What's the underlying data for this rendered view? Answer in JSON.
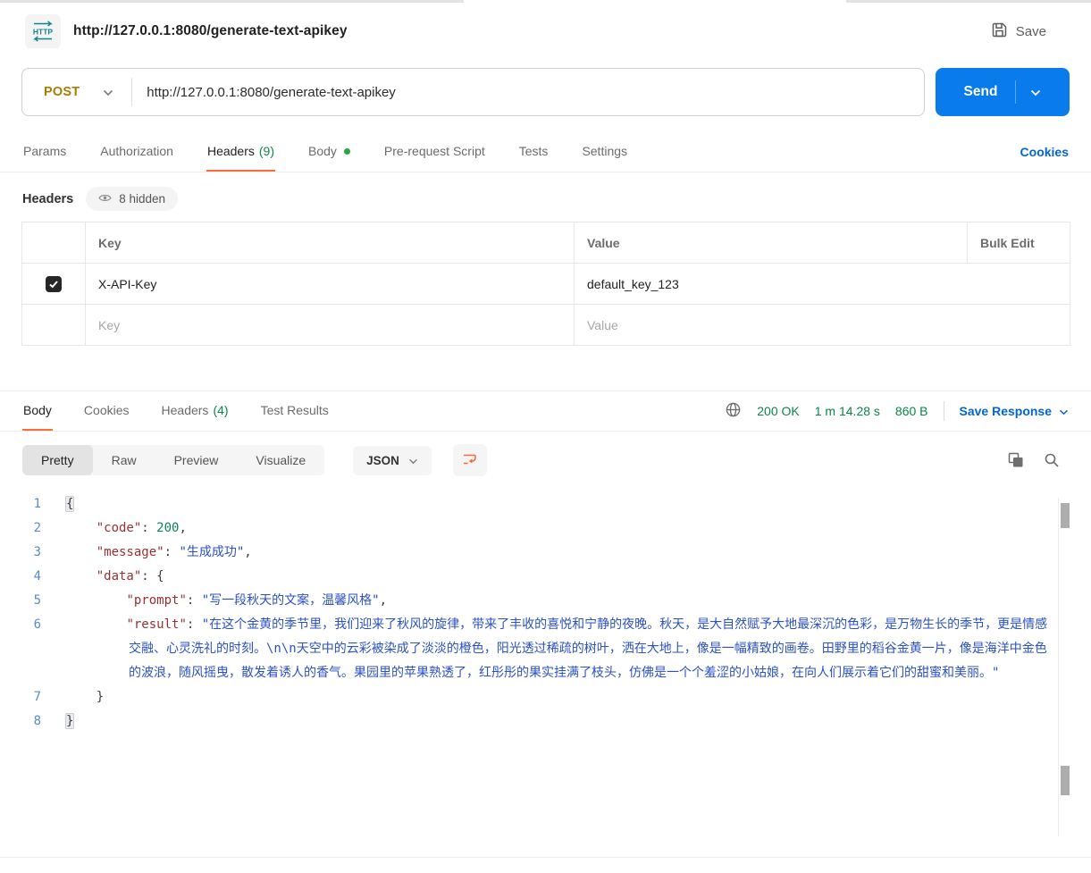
{
  "header": {
    "badge": "HTTP",
    "title": "http://127.0.0.1:8080/generate-text-apikey",
    "save_label": "Save"
  },
  "request": {
    "method": "POST",
    "url": "http://127.0.0.1:8080/generate-text-apikey",
    "send_label": "Send"
  },
  "request_tabs": {
    "items": [
      {
        "label": "Params"
      },
      {
        "label": "Authorization"
      },
      {
        "label": "Headers",
        "count": "(9)",
        "active": true
      },
      {
        "label": "Body",
        "dot": true
      },
      {
        "label": "Pre-request Script"
      },
      {
        "label": "Tests"
      },
      {
        "label": "Settings"
      }
    ],
    "cookies_link": "Cookies"
  },
  "headers_editor": {
    "title": "Headers",
    "hidden_badge": "8 hidden",
    "columns": {
      "key": "Key",
      "value": "Value",
      "bulk": "Bulk Edit"
    },
    "rows": [
      {
        "key": "X-API-Key",
        "value": "default_key_123",
        "checked": true
      }
    ],
    "placeholder": {
      "key": "Key",
      "value": "Value"
    }
  },
  "response": {
    "tabs": [
      {
        "label": "Body",
        "active": true
      },
      {
        "label": "Cookies"
      },
      {
        "label": "Headers",
        "count": "(4)"
      },
      {
        "label": "Test Results"
      }
    ],
    "status": "200 OK",
    "time": "1 m 14.28 s",
    "size": "860 B",
    "save_response": "Save Response"
  },
  "viewer": {
    "modes": [
      "Pretty",
      "Raw",
      "Preview",
      "Visualize"
    ],
    "active_mode": "Pretty",
    "language": "JSON"
  },
  "code": {
    "lines": [
      {
        "n": 1,
        "tokens": [
          {
            "t": "hl",
            "v": "{"
          }
        ]
      },
      {
        "n": 2,
        "tokens": [
          {
            "t": "p",
            "v": "    "
          },
          {
            "t": "k",
            "v": "\"code\""
          },
          {
            "t": "p",
            "v": ": "
          },
          {
            "t": "n",
            "v": "200"
          },
          {
            "t": "p",
            "v": ","
          }
        ]
      },
      {
        "n": 3,
        "tokens": [
          {
            "t": "p",
            "v": "    "
          },
          {
            "t": "k",
            "v": "\"message\""
          },
          {
            "t": "p",
            "v": ": "
          },
          {
            "t": "s",
            "v": "\"生成成功\""
          },
          {
            "t": "p",
            "v": ","
          }
        ]
      },
      {
        "n": 4,
        "tokens": [
          {
            "t": "p",
            "v": "    "
          },
          {
            "t": "k",
            "v": "\"data\""
          },
          {
            "t": "p",
            "v": ": "
          },
          {
            "t": "p",
            "v": "{"
          }
        ]
      },
      {
        "n": 5,
        "tokens": [
          {
            "t": "p",
            "v": "        "
          },
          {
            "t": "k",
            "v": "\"prompt\""
          },
          {
            "t": "p",
            "v": ": "
          },
          {
            "t": "s",
            "v": "\"写一段秋天的文案，温馨风格\""
          },
          {
            "t": "p",
            "v": ","
          }
        ]
      },
      {
        "n": 6,
        "wrap": true,
        "tokens": [
          {
            "t": "p",
            "v": "        "
          },
          {
            "t": "k",
            "v": "\"result\""
          },
          {
            "t": "p",
            "v": ": "
          },
          {
            "t": "s",
            "v": "\"在这个金黄的季节里，我们迎来了秋风的旋律，带来了丰收的喜悦和宁静的夜晚。秋天，是大自然赋予大地最深沉的色彩，是万物生长的季节，更是情感交融、心灵洗礼的时刻。\\n\\n天空中的云彩被染成了淡淡的橙色，阳光透过稀疏的树叶，洒在大地上，像是一幅精致的画卷。田野里的稻谷金黄一片，像是海洋中金色的波浪，随风摇曳，散发着诱人的香气。果园里的苹果熟透了，红彤彤的果实挂满了枝头，仿佛是一个个羞涩的小姑娘，在向人们展示着它们的甜蜜和美丽。\""
          }
        ]
      },
      {
        "n": 7,
        "tokens": [
          {
            "t": "p",
            "v": "    }"
          }
        ]
      },
      {
        "n": 8,
        "tokens": [
          {
            "t": "hl",
            "v": "}"
          }
        ]
      }
    ]
  }
}
